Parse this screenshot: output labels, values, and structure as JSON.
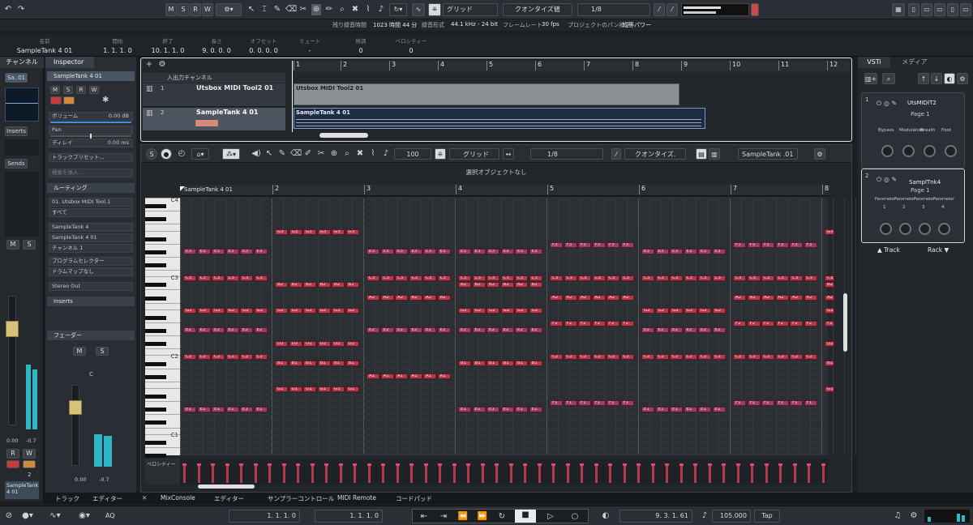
{
  "toolbar": {
    "mode_m": "M",
    "mode_s": "S",
    "mode_r": "R",
    "mode_w": "W",
    "grid_label": "グリッド",
    "quantize_type": "クオンタイズ値",
    "quantize_value": "1/8"
  },
  "info": {
    "remain_label": "残り録音時間",
    "remain_value": "1023 時間 44 分",
    "format_label": "録音形式",
    "format_value": "44.1 kHz - 24 bit",
    "frame_label": "フレームレート",
    "frame_value": "30 fps",
    "pan_label": "プロジェクトのパン補正",
    "pan_value": "均等パワー"
  },
  "status": {
    "name_h": "名前",
    "name_v": "SampleTank 4 01",
    "start_h": "開始",
    "start_v": "1. 1. 1. 0",
    "end_h": "終了",
    "end_v": "10. 1. 1. 0",
    "len_h": "長さ",
    "len_v": "9. 0. 0. 0",
    "offset_h": "オフセット",
    "offset_v": "0. 0. 0. 0",
    "mute_h": "ミュート",
    "mute_v": "-",
    "trans_h": "移調",
    "trans_v": "0",
    "vel_h": "ベロシティー",
    "vel_v": "0"
  },
  "left": {
    "tab": "チャンネル",
    "name": "Sa..01",
    "inserts": "Inserts",
    "sends": "Sends",
    "m": "M",
    "s": "S",
    "r": "R",
    "w": "W",
    "val1": "0.00",
    "val2": "-0.7",
    "track_num": "2",
    "track_name": "SampleTank 4 01"
  },
  "inspector": {
    "tab": "Inspector",
    "track": "SampleTank 4 01",
    "volume_label": "ボリューム",
    "volume_value": "0.00 dB",
    "pan_label": "Pan",
    "pan_value": "C",
    "delay_label": "ディレイ",
    "delay_value": "0.00 ms",
    "preset": "トラックプリセット...",
    "search": "検索を挿入...",
    "routing": "ルーティング",
    "in_port": "01. Utsbox MIDI Tool.1",
    "all": "すべて",
    "out_inst": "SampleTank 4",
    "out_port": "SampleTank 4 01",
    "channel": "チャンネル 1",
    "prog": "プログラムセレクター",
    "drum": "ドラムマップなし",
    "stereo": "Stereo Out",
    "inserts": "Inserts",
    "fader": "フェーダー",
    "fm": "M",
    "fs": "S",
    "fc": "C",
    "f1": "0.00",
    "f2": "-0.7"
  },
  "project": {
    "io_label": "入出力チャンネル",
    "tracks": [
      {
        "num": "1",
        "name": "Utsbox MIDI Tool2 01"
      },
      {
        "num": "2",
        "name": "SampleTank 4 01"
      }
    ],
    "ruler": [
      "1",
      "2",
      "3",
      "4",
      "5",
      "6",
      "7",
      "8",
      "9",
      "10",
      "11",
      "12"
    ],
    "part1": "Utsbox MIDI Tool2 01",
    "part2": "SampleTank 4 01"
  },
  "editor": {
    "velocity_num": "100",
    "grid": "グリッド",
    "qvalue": "1/8",
    "quantize": "クオンタイズ.",
    "track_sel": "SampleTank .01",
    "no_sel": "選択オブジェクトなし",
    "part_name": "SampleTank 4 01",
    "ruler": [
      "2",
      "3",
      "4",
      "5",
      "6",
      "7",
      "8"
    ],
    "velo_label": "ベロシティー",
    "keys": [
      "C4",
      "C3",
      "C2",
      "C1"
    ],
    "notes": [
      {
        "n": "G3",
        "row": "g3",
        "bars": [
          1
        ],
        "cnt": 6
      },
      {
        "n": "E3",
        "row": "e3",
        "bars": [
          0,
          2,
          3,
          5
        ],
        "cnt": 6
      },
      {
        "n": "F3",
        "row": "f3",
        "bars": [
          4,
          6
        ],
        "cnt": 6
      },
      {
        "n": "C3",
        "row": "c3",
        "bars": [
          0,
          2,
          3,
          4,
          5,
          6
        ],
        "cnt": 6
      },
      {
        "n": "B2",
        "row": "b2",
        "bars": [
          1,
          3
        ],
        "cnt": 6
      },
      {
        "n": "A2",
        "row": "a2",
        "bars": [
          2,
          4,
          6
        ],
        "cnt": 6
      },
      {
        "n": "G2",
        "row": "g2",
        "bars": [
          0,
          1,
          3,
          5
        ],
        "cnt": 6
      },
      {
        "n": "F2",
        "row": "f2",
        "bars": [
          4,
          6
        ],
        "cnt": 6
      },
      {
        "n": "E2",
        "row": "e2",
        "bars": [
          0,
          2,
          3,
          5
        ],
        "cnt": 6
      },
      {
        "n": "D2",
        "row": "d2",
        "bars": [
          1
        ],
        "cnt": 6
      },
      {
        "n": "C2",
        "row": "c2",
        "bars": [
          0,
          4,
          5,
          6
        ],
        "cnt": 6
      },
      {
        "n": "B1",
        "row": "b1",
        "bars": [
          1,
          3
        ],
        "cnt": 6
      },
      {
        "n": "A1",
        "row": "a1",
        "bars": [
          2
        ],
        "cnt": 6
      },
      {
        "n": "G1",
        "row": "g1",
        "bars": [
          1
        ],
        "cnt": 6
      },
      {
        "n": "F1",
        "row": "f1",
        "bars": [
          4,
          6
        ],
        "cnt": 6
      },
      {
        "n": "E1",
        "row": "e1",
        "bars": [
          0,
          3,
          5
        ],
        "cnt": 6
      }
    ]
  },
  "vsti": {
    "tab1": "VSTi",
    "tab2": "メディア",
    "slot1_num": "1",
    "slot1_name": "UtsMIDIT2",
    "slot1_page": "Page 1",
    "slot1_params": [
      "Bypass",
      "Modulation",
      "Breath",
      "Foot"
    ],
    "slot2_num": "2",
    "slot2_name": "SamplTnk4",
    "slot2_page": "Page 1",
    "slot2_params": [
      "Parameter",
      "Parameter",
      "Parameter",
      "Parameter"
    ],
    "slot2_sub": [
      "1",
      "2",
      "3",
      "4"
    ],
    "track_btn": "Track",
    "rack_btn": "Rack"
  },
  "bottom_tabs": [
    "トラック",
    "エディター",
    "MixConsole",
    "エディター",
    "サンプラーコントロール",
    "MIDI Remote",
    "コードパッド"
  ],
  "transport": {
    "aq": "AQ",
    "left_loc": "1. 1. 1. 0",
    "right_loc": "1. 1. 1. 0",
    "position": "9. 3. 1. 61",
    "tempo": "105.000",
    "tap": "Tap"
  }
}
